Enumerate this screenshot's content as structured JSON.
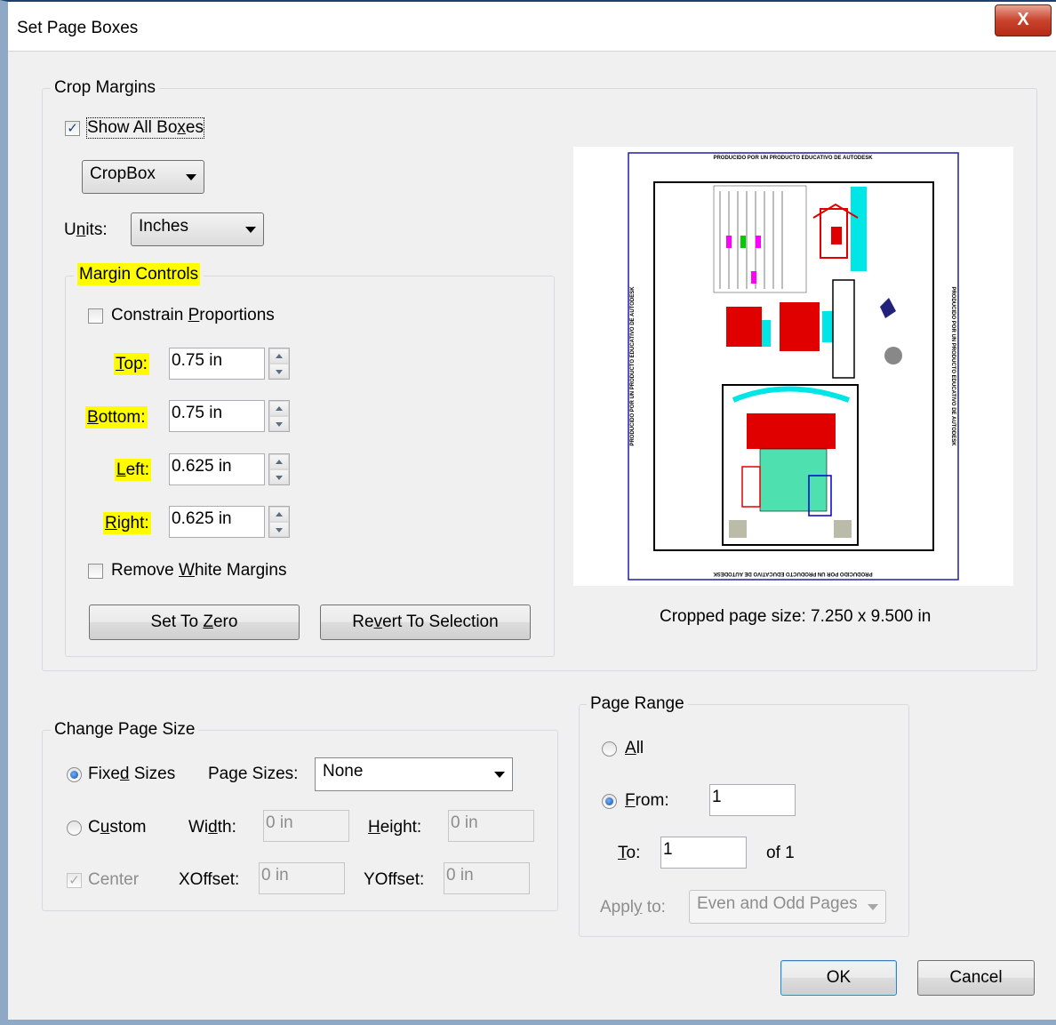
{
  "window": {
    "title": "Set Page Boxes",
    "close_glyph": "X"
  },
  "crop_margins": {
    "group_label": "Crop Margins",
    "show_all_boxes": {
      "label_pre": "Show All Bo",
      "label_u": "x",
      "label_post": "es",
      "checked": true,
      "glyph": "✓"
    },
    "box_select": {
      "value": "CropBox"
    },
    "units": {
      "label_pre": "U",
      "label_u": "n",
      "label_post": "its:",
      "value": "Inches"
    },
    "margin_controls": {
      "group_label": "Margin Controls",
      "constrain": {
        "label_pre": "Constrain ",
        "label_u": "P",
        "label_post": "roportions",
        "checked": false
      },
      "top": {
        "label_pre": "",
        "label_u": "T",
        "label_post": "op:",
        "value": "0.75 in"
      },
      "bottom": {
        "label_pre": "",
        "label_u": "B",
        "label_post": "ottom:",
        "value": "0.75 in"
      },
      "left": {
        "label_pre": "",
        "label_u": "L",
        "label_post": "eft:",
        "value": "0.625 in"
      },
      "right": {
        "label_pre": "",
        "label_u": "R",
        "label_post": "ight:",
        "value": "0.625 in"
      },
      "remove_white": {
        "label_pre": "Remove ",
        "label_u": "W",
        "label_post": "hite Margins",
        "checked": false
      },
      "set_to_zero": {
        "label_pre": "Set To ",
        "label_u": "Z",
        "label_post": "ero"
      },
      "revert": {
        "label_pre": "Re",
        "label_u": "v",
        "label_post": "ert To Selection"
      }
    },
    "preview": {
      "header_text": "PRODUCIDO POR UN PRODUCTO EDUCATIVO DE AUTODESK",
      "footer_text": "PRODUCIDO POR UN PRODUCTO EDUCATIVO DE AUTODESK",
      "left_text": "PRODUCIDO POR UN PRODUCTO EDUCATIVO DE AUTODESK",
      "right_text": "PRODUCIDO POR UN PRODUCTO EDUCATIVO DE AUTODESK"
    },
    "cropped_size": "Cropped page size: 7.250 x 9.500 in"
  },
  "change_page_size": {
    "group_label": "Change Page Size",
    "fixed_sizes": {
      "label_pre": "Fixe",
      "label_u": "d",
      "label_post": " Sizes",
      "selected": true
    },
    "page_sizes": {
      "label_pre": "Pa",
      "label_u": "g",
      "label_post": "e Sizes:",
      "value": "None"
    },
    "custom": {
      "label_pre": "C",
      "label_u": "u",
      "label_post": "stom",
      "selected": false
    },
    "width": {
      "label_pre": "Wi",
      "label_u": "d",
      "label_post": "th:",
      "value": "0 in"
    },
    "height": {
      "label_pre": "",
      "label_u": "H",
      "label_post": "eight:",
      "value": "0 in"
    },
    "center": {
      "label": "Center",
      "checked": true,
      "glyph": "✓"
    },
    "xoffset": {
      "label": "XOffset:",
      "value": "0 in"
    },
    "yoffset": {
      "label": "YOffset:",
      "value": "0 in"
    }
  },
  "page_range": {
    "group_label": "Page Range",
    "all": {
      "label_pre": "",
      "label_u": "A",
      "label_post": "ll",
      "selected": false
    },
    "from": {
      "label_pre": "",
      "label_u": "F",
      "label_post": "rom:",
      "value": "1",
      "selected": true
    },
    "to": {
      "label_pre": "",
      "label_u": "T",
      "label_post": "o:",
      "value": "1"
    },
    "of": "of 1",
    "apply_to": {
      "label_pre": "Appl",
      "label_u": "y",
      "label_post": " to:",
      "value": "Even and Odd Pages"
    }
  },
  "buttons": {
    "ok": "OK",
    "cancel": "Cancel"
  },
  "colors": {
    "highlight": "#fffc00",
    "crop_frame": "#1f1fa8",
    "accent_red": "#e00000",
    "accent_cyan": "#00e5e5"
  }
}
